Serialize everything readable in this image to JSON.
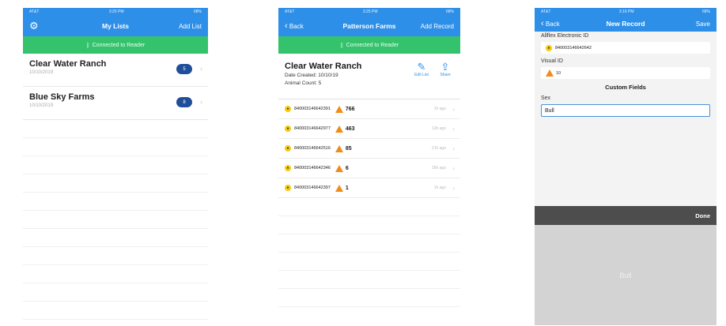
{
  "screen1": {
    "status": {
      "carrier": "AT&T",
      "time": "3:25 PM",
      "battery": "68%"
    },
    "nav": {
      "title": "My Lists",
      "right": "Add List"
    },
    "banner": "Connected to Reader",
    "lists": [
      {
        "name": "Clear Water Ranch",
        "date": "10/10/2019",
        "count": "5"
      },
      {
        "name": "Blue Sky Farms",
        "date": "10/10/2019",
        "count": "8"
      }
    ]
  },
  "screen2": {
    "status": {
      "carrier": "AT&T",
      "time": "3:25 PM",
      "battery": "68%"
    },
    "nav": {
      "back": "Back",
      "title": "Patterson Farms",
      "right": "Add Record"
    },
    "banner": "Connected to Reader",
    "header": {
      "name": "Clear Water Ranch",
      "date_created": "Date Created: 10/10/19",
      "animal_count": "Animal Count: 5",
      "edit_label": "Edit List",
      "share_label": "Share"
    },
    "records": [
      {
        "eid": "840003146642391",
        "vid": "766",
        "ago": "1h ago"
      },
      {
        "eid": "840003146642977",
        "vid": "463",
        "ago": "13h ago"
      },
      {
        "eid": "840003146642516",
        "vid": "85",
        "ago": "21h ago"
      },
      {
        "eid": "840003146642346",
        "vid": "6",
        "ago": "26h ago"
      },
      {
        "eid": "840003146642397",
        "vid": "1",
        "ago": "1h ago"
      }
    ]
  },
  "screen3": {
    "status": {
      "carrier": "AT&T",
      "time": "3:16 PM",
      "battery": "68%"
    },
    "nav": {
      "back": "Back",
      "title": "New Record",
      "right": "Save"
    },
    "eid_label": "Allflex Electronic ID",
    "eid_value": "840003146642642",
    "vid_label": "Visual ID",
    "vid_value": "10",
    "custom_title": "Custom Fields",
    "sex_label": "Sex",
    "sex_value": "Bull",
    "done_label": "Done",
    "picker_value": "Bull"
  }
}
